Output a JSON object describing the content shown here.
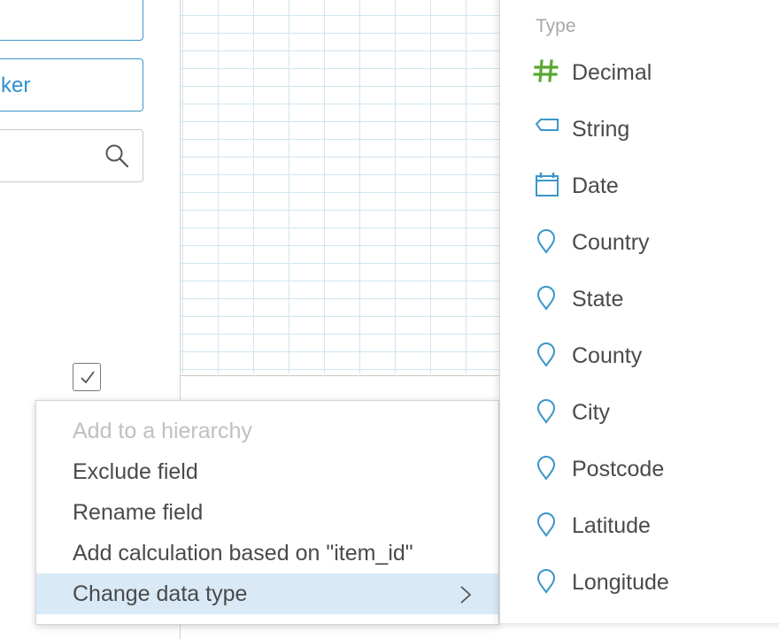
{
  "left_panel": {
    "field_2_text": "ker",
    "search_placeholder": ""
  },
  "context_menu": {
    "items": [
      {
        "label": "Add to a hierarchy",
        "disabled": true
      },
      {
        "label": "Exclude field"
      },
      {
        "label": "Rename field"
      },
      {
        "label": "Add calculation based on \"item_id\""
      },
      {
        "label": "Change data type",
        "active": true,
        "submenu": true
      }
    ]
  },
  "type_menu": {
    "header": "Type",
    "items": [
      {
        "label": "Decimal",
        "icon": "hash-icon"
      },
      {
        "label": "String",
        "icon": "tag-icon"
      },
      {
        "label": "Date",
        "icon": "calendar-icon"
      },
      {
        "label": "Country",
        "icon": "map-pin-icon"
      },
      {
        "label": "State",
        "icon": "map-pin-icon"
      },
      {
        "label": "County",
        "icon": "map-pin-icon"
      },
      {
        "label": "City",
        "icon": "map-pin-icon"
      },
      {
        "label": "Postcode",
        "icon": "map-pin-icon"
      },
      {
        "label": "Latitude",
        "icon": "map-pin-icon"
      },
      {
        "label": "Longitude",
        "icon": "map-pin-icon"
      }
    ]
  },
  "colors": {
    "accent": "#3a97c9",
    "decimal_icon": "#5aa832",
    "highlight": "#d9eaf6"
  }
}
